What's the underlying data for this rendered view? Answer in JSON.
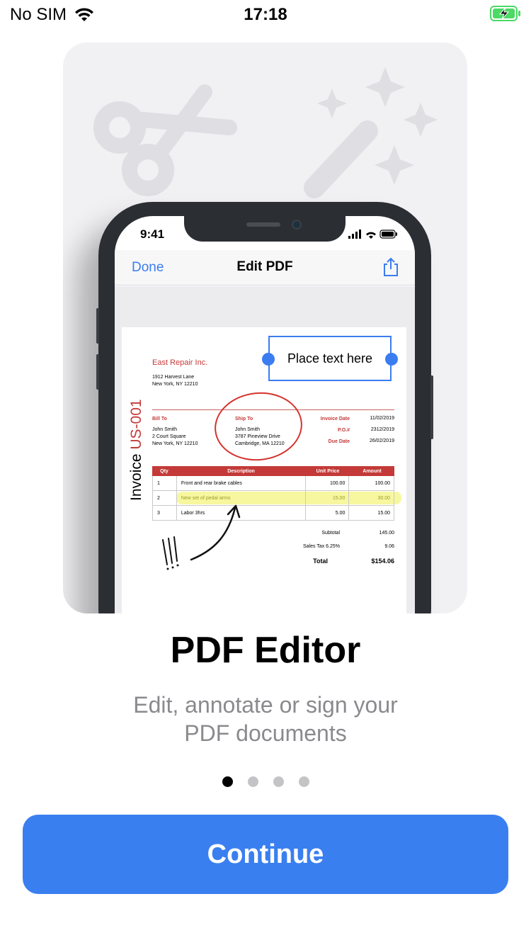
{
  "status_bar": {
    "carrier": "No SIM",
    "time": "17:18",
    "battery_color": "#4cd964"
  },
  "hero": {
    "background_icons": [
      "scissors-icon",
      "magic-wand-icon"
    ],
    "phone": {
      "time": "9:41",
      "nav": {
        "done_label": "Done",
        "title": "Edit PDF",
        "share_icon": "share-icon"
      },
      "document": {
        "vertical_title_prefix": "Invoice",
        "vertical_title_number": "US-001",
        "company": "East Repair Inc.",
        "company_address": [
          "1912 Harvest Lane",
          "New York, NY 12210"
        ],
        "bill_to_label": "Bill To",
        "bill_to": [
          "John Smith",
          "2 Court Square",
          "New York, NY 12210"
        ],
        "ship_to_label": "Ship To",
        "ship_to": [
          "John Smith",
          "3787 Pineview Drive",
          "Cambridge, MA 12210"
        ],
        "meta": [
          {
            "label": "Invoice Date",
            "value": "11/02/2019"
          },
          {
            "label": "P.O.#",
            "value": "2312/2019"
          },
          {
            "label": "Due Date",
            "value": "26/02/2019"
          }
        ],
        "table": {
          "headers": [
            "Qty",
            "Description",
            "Unit Price",
            "Amount"
          ],
          "rows": [
            [
              "1",
              "Front and rear brake cables",
              "100.00",
              "100.00"
            ],
            [
              "2",
              "New set of pedal arms",
              "15.00",
              "30.00"
            ],
            [
              "3",
              "Labor 3hrs",
              "5.00",
              "15.00"
            ]
          ]
        },
        "totals": [
          {
            "label": "Subtotal",
            "value": "145.00"
          },
          {
            "label": "Sales Tax 6.25%",
            "value": "9.06"
          },
          {
            "label": "Total",
            "value": "$154.06"
          }
        ],
        "place_text": "Place text here",
        "annotation_color": "#d5342e",
        "highlight_color": "#f0f050"
      }
    }
  },
  "title": "PDF Editor",
  "subtitle_line1": "Edit, annotate or sign your",
  "subtitle_line2": "PDF documents",
  "page_indicator": {
    "count": 4,
    "active_index": 0
  },
  "continue_label": "Continue",
  "accent_color": "#3a7ff0"
}
